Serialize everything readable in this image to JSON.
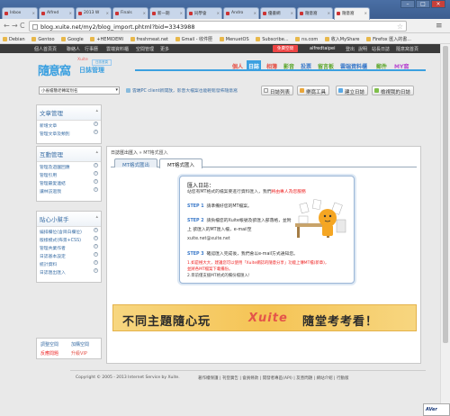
{
  "browser": {
    "tabs": [
      {
        "label": "Inbox"
      },
      {
        "label": "Alfred"
      },
      {
        "label": "2013 W"
      },
      {
        "label": "Finals"
      },
      {
        "label": "新一期"
      },
      {
        "label": "同學會"
      },
      {
        "label": "Andro"
      },
      {
        "label": "優書網"
      },
      {
        "label": "隨意窩"
      },
      {
        "label": "隨意窩",
        "active": true
      }
    ],
    "tab_close": "×",
    "win_min": "–",
    "win_max": "□",
    "win_close": "×",
    "back": "←",
    "forward": "→",
    "reload": "C",
    "url": "blog.xuite.net/my2/blog_import.phtml?bid=3343988",
    "star": "☆",
    "menu": "≡",
    "bookmarks": [
      "Debian",
      "Gentoo",
      "Google",
      "+HEMIDEMI",
      "freshmeat.net",
      "Gmail - 收件匣",
      "MenuetOS",
      "Subscribe...",
      "ns.com",
      "收入MyShare",
      "Firefox 匯入的書..."
    ]
  },
  "xuite": {
    "topbar": [
      "個人首頁頁",
      "聯絡人",
      "行事曆",
      "雲端資料櫃",
      "空間管理",
      "更多"
    ],
    "register": "免費空間",
    "user": "alfredtaipei",
    "topright": [
      "登出",
      "說明",
      "站長日誌",
      "隨意窩首頁"
    ],
    "logo_main": "隨意窩",
    "logo_sub": "日誌管理",
    "logo_top": "Xuite",
    "logo_mini": "日誌首頁",
    "services": [
      {
        "label": "個人",
        "color": "#e4544a"
      },
      {
        "label": "日誌",
        "color": "#ffffff",
        "active": true
      },
      {
        "label": "相簿",
        "color": "#e4544a"
      },
      {
        "label": "影音",
        "color": "#5aa52a"
      },
      {
        "label": "投票",
        "color": "#3a79c9"
      },
      {
        "label": "留言板",
        "color": "#5aa52a"
      },
      {
        "label": "雲端資料櫃",
        "color": "#3a79c9"
      },
      {
        "label": "郵件",
        "color": "#5aa52a"
      },
      {
        "label": "MY窩",
        "color": "#b84ad0"
      }
    ],
    "blog_select": "小雀檔簡老轉寫別名",
    "blog_select_arrow": "▾",
    "notice": "雲端PC client新開放，影音大檔案也能輕鬆發佈隨意窩",
    "buttons": [
      "日誌列表",
      "樂窩工具",
      "建立日誌",
      "檢視我的日誌"
    ]
  },
  "sidebar": {
    "panels": [
      {
        "title": "文章管理",
        "items": [
          "新增文章",
          "管理文章及類別"
        ]
      },
      {
        "title": "互動管理",
        "items": [
          "管理及遊園回應",
          "管理引用",
          "管理最愛連結",
          "讓林訪過我"
        ]
      },
      {
        "title": "貼心小幫手",
        "items": [
          "編排欄位(含目白欄位)",
          "版樣模式(佈景+CSS)",
          "管理共業作者",
          "日誌基本設定",
          "統計資料",
          "日誌匯出匯入"
        ]
      }
    ],
    "collapse": "▴",
    "help": "?",
    "bottom": [
      {
        "label": "調整空間",
        "color": "#3a6ea5"
      },
      {
        "label": "加購空間",
        "color": "#3a6ea5"
      },
      {
        "label": "反應問題",
        "color": "#e22"
      },
      {
        "label": "升級VIP",
        "color": "#e4544a"
      }
    ]
  },
  "main": {
    "breadcrumb_sep": "»",
    "breadcrumb": [
      "日誌匯出匯入",
      "MT格式匯入"
    ],
    "tabs": [
      {
        "label": "MT格式匯出"
      },
      {
        "label": "MT格式匯入",
        "active": true
      }
    ],
    "import": {
      "title": "匯入日誌：",
      "intro": "站您有MT格式的檔案要進行資料匯入，我們",
      "intro_red": "將由專人為您服務",
      "step1_label": "STEP 1",
      "step1": "請準備好您的MT檔案。",
      "step2_label": "STEP 2",
      "step2": "請負檔您的Xuite帳號及欲匯入部落格，並附",
      "step2b": "上        欲匯入的MT匯入檔，e-mail至",
      "email": "xuite.net@xuite.net",
      "step3_label": "STEP 3",
      "step3": "確認匯入完成後，我們會以e-mail方式通知您。",
      "note1": "1.如是極大大，建議您可以使用「Xuite網誌的隨意分享」功能上傳MT檔(新章)，",
      "note2": "並將各MT檔案下載備份。",
      "note3": "2.目前僅支援MT格式的備份檔匯入!"
    },
    "banner_left": "不同主題隨心玩",
    "banner_xuite": "Xuite",
    "banner_right": "隨堂考考看！"
  },
  "footer": {
    "copyright": "Copyright © 2005 - 2013 Internet Service by Xuite.",
    "links": [
      "著作權保護",
      "刊登廣告",
      "會員條款",
      "開發者專區(API)",
      "友善問題",
      "網站介紹",
      "行動版"
    ]
  },
  "overlay": {
    "label": "AVer"
  },
  "colors": {
    "accent": "#3ba0e0",
    "link": "#3a6ea5",
    "red": "#e22"
  }
}
